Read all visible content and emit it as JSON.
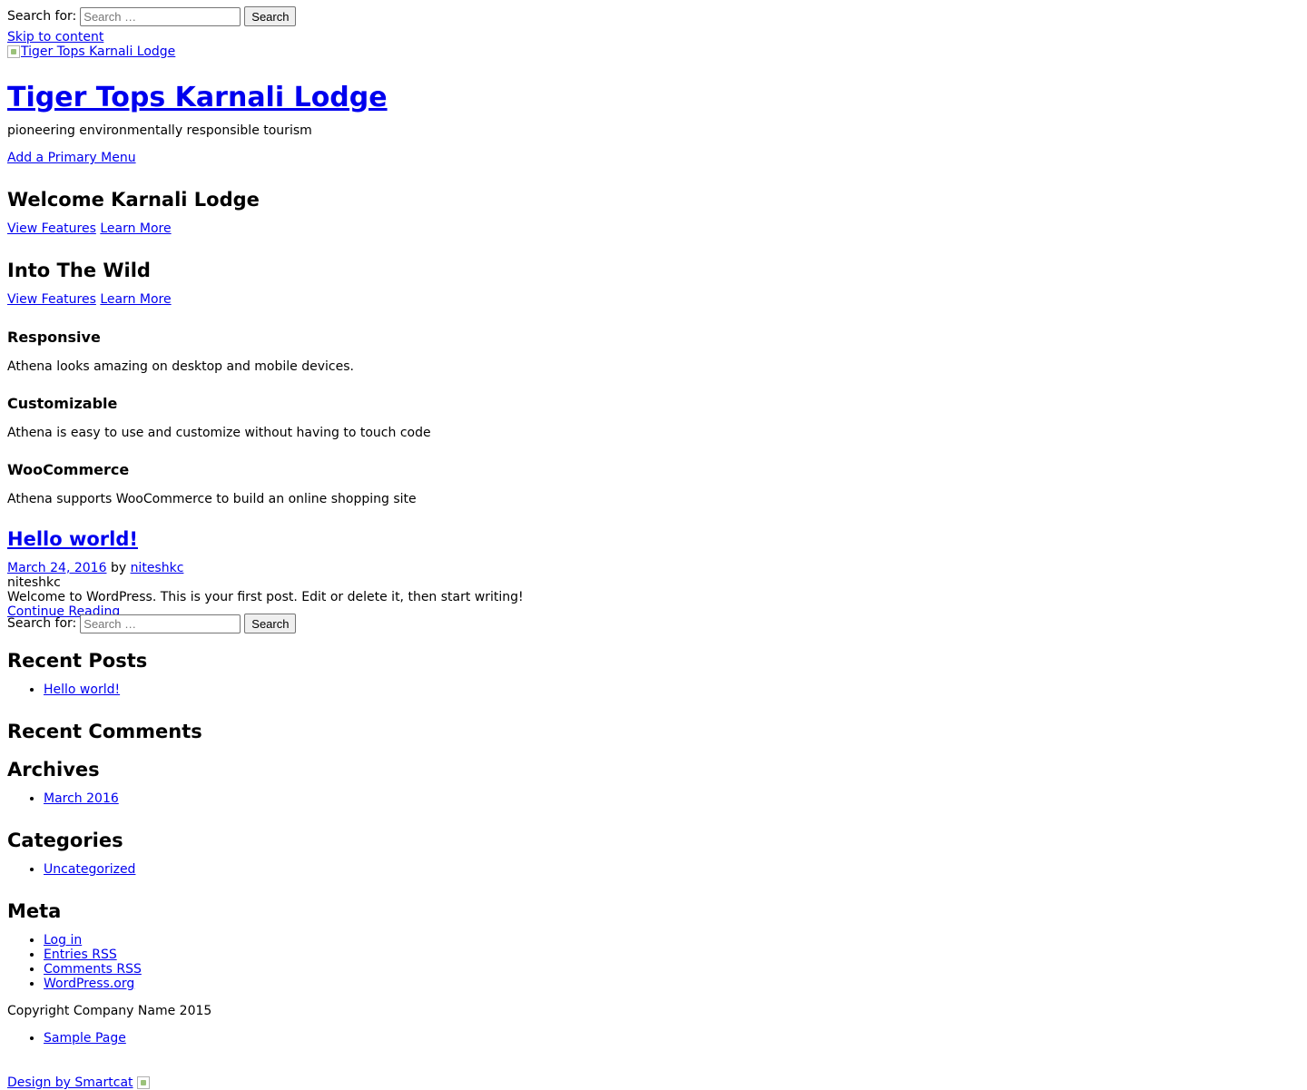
{
  "search_top": {
    "label": "Search for:",
    "placeholder": "Search …",
    "button": "Search"
  },
  "header": {
    "skip_link": "Skip to content",
    "logo_alt": "Tiger Tops Karnali Lodge",
    "site_title": "Tiger Tops Karnali Lodge",
    "tagline": "pioneering environmentally responsible tourism",
    "primary_menu": "Add a Primary Menu"
  },
  "slides": [
    {
      "title": "Welcome Karnali Lodge",
      "link1": "View Features",
      "link2": "Learn More"
    },
    {
      "title": "Into The Wild",
      "link1": "View Features",
      "link2": "Learn More"
    }
  ],
  "features": [
    {
      "title": "Responsive",
      "text": "Athena looks amazing on desktop and mobile devices."
    },
    {
      "title": "Customizable",
      "text": "Athena is easy to use and customize without having to touch code"
    },
    {
      "title": "WooCommerce",
      "text": "Athena supports WooCommerce to build an online shopping site"
    }
  ],
  "post": {
    "title": "Hello world!",
    "date": "March 24, 2016",
    "by": "by",
    "author": "niteshkc",
    "author_plain": "niteshkc",
    "excerpt": "Welcome to WordPress. This is your first post. Edit or delete it, then start writing!",
    "continue": "Continue Reading"
  },
  "search_sidebar": {
    "label": "Search for:",
    "placeholder": "Search …",
    "button": "Search"
  },
  "widgets": {
    "recent_posts": {
      "title": "Recent Posts",
      "items": [
        "Hello world!"
      ]
    },
    "recent_comments": {
      "title": "Recent Comments"
    },
    "archives": {
      "title": "Archives",
      "items": [
        "March 2016"
      ]
    },
    "categories": {
      "title": "Categories",
      "items": [
        "Uncategorized"
      ]
    },
    "meta": {
      "title": "Meta",
      "items": [
        "Log in",
        "Entries RSS",
        "Comments RSS",
        "WordPress.org"
      ]
    }
  },
  "footer": {
    "copyright": "Copyright Company Name 2015",
    "menu": [
      "Sample Page"
    ],
    "credit": "Design by Smartcat"
  },
  "colors": {
    "link": "#0000ee",
    "text": "#000000",
    "background": "#ffffff"
  }
}
